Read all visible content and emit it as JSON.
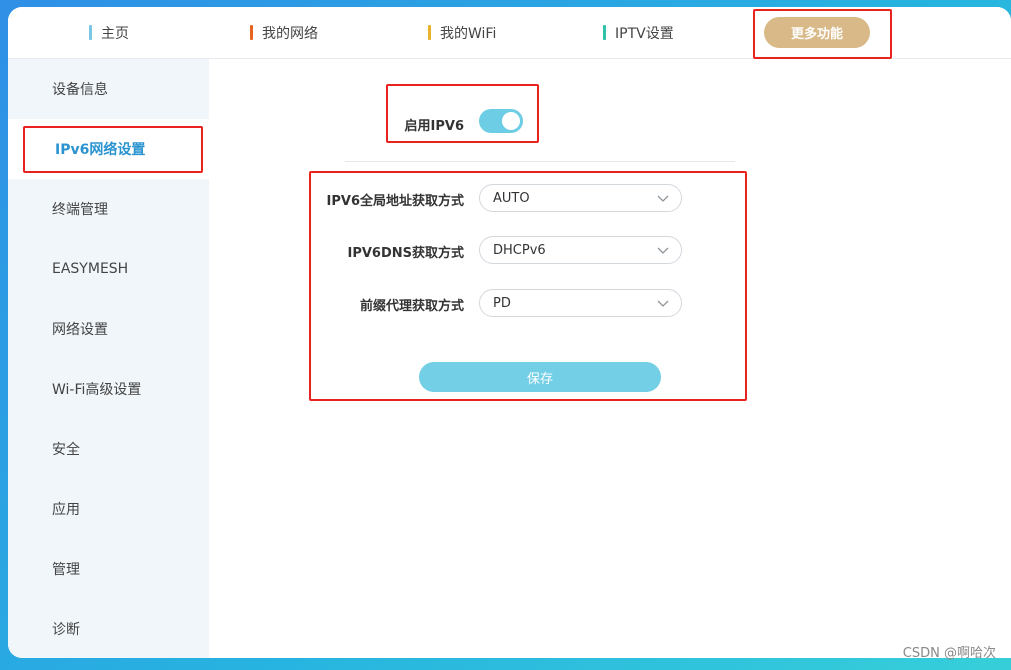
{
  "topnav": {
    "items": [
      {
        "label": "主页",
        "color": "#7ac6e4"
      },
      {
        "label": "我的网络",
        "color": "#e9651f"
      },
      {
        "label": "我的WiFi",
        "color": "#e8b22a"
      },
      {
        "label": "IPTV设置",
        "color": "#2ec2a8"
      }
    ],
    "more_label": "更多功能",
    "more_color": "#d9b987"
  },
  "sidebar": {
    "items": [
      {
        "label": "设备信息"
      },
      {
        "label": "IPv6网络设置",
        "active": true
      },
      {
        "label": "终端管理"
      },
      {
        "label": "EASYMESH"
      },
      {
        "label": "网络设置"
      },
      {
        "label": "Wi-Fi高级设置"
      },
      {
        "label": "安全"
      },
      {
        "label": "应用"
      },
      {
        "label": "管理"
      },
      {
        "label": "诊断"
      }
    ]
  },
  "form": {
    "enable_label": "启用IPV6",
    "enable_on": true,
    "fields": [
      {
        "label": "IPV6全局地址获取方式",
        "value": "AUTO"
      },
      {
        "label": "IPV6DNS获取方式",
        "value": "DHCPv6"
      },
      {
        "label": "前缀代理获取方式",
        "value": "PD"
      }
    ],
    "save_label": "保存"
  },
  "colors": {
    "accent": "#6dcde4",
    "highlight_box": "#e8221f",
    "active_text": "#2b94d0"
  },
  "watermark": "CSDN @啊哈次"
}
